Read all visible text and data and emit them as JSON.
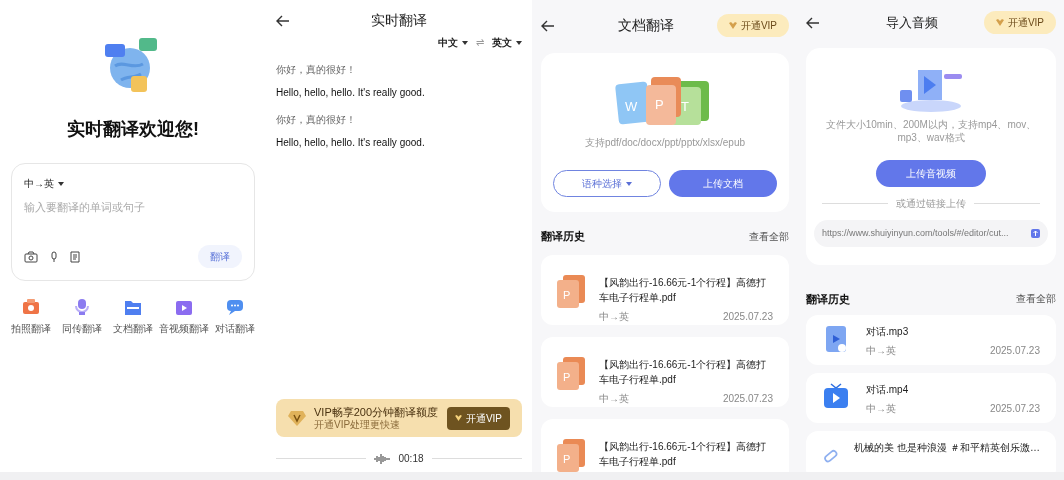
{
  "welcome": {
    "title": "实时翻译欢迎您!",
    "lang_pair": "中→英",
    "placeholder": "输入要翻译的单词或句子",
    "translate_button": "翻译",
    "tools": [
      {
        "kind": "camera",
        "label": "拍照翻译"
      },
      {
        "kind": "interpreter",
        "label": "同传翻译"
      },
      {
        "kind": "document",
        "label": "文档翻译"
      },
      {
        "kind": "video",
        "label": "音视频翻译"
      },
      {
        "kind": "chat",
        "label": "对话翻译"
      }
    ]
  },
  "live": {
    "title": "实时翻译",
    "source_lang": "中文",
    "swap": "⇌",
    "target_lang": "英文",
    "lines": [
      {
        "kind": "source",
        "text": "你好，真的很好！"
      },
      {
        "kind": "target",
        "text": "Hello, hello, hello. It's really good."
      },
      {
        "kind": "source",
        "text": "你好，真的很好！"
      },
      {
        "kind": "target",
        "text": "Hello, hello, hello. It's really good."
      }
    ],
    "vip_banner": {
      "title": "VIP畅享200分钟翻译额度",
      "subtitle": "开通VIP处理更快速",
      "button": "开通VIP"
    },
    "recording_time": "00:18"
  },
  "document": {
    "title": "文档翻译",
    "vip_button": "开通VIP",
    "file_badges": [
      "W",
      "P",
      "T"
    ],
    "formats": "支持pdf/doc/docx/ppt/pptx/xlsx/epub",
    "language_select": "语种选择",
    "upload_button": "上传文档",
    "history_title": "翻译历史",
    "view_all": "查看全部",
    "history": [
      {
        "badge": "P",
        "name": "【风韵出行-16.66元-1个行程】高德打车电子行程单.pdf",
        "langs": "中→英",
        "date": "2025.07.23"
      },
      {
        "badge": "P",
        "name": "【风韵出行-16.66元-1个行程】高德打车电子行程单.pdf",
        "langs": "中→英",
        "date": "2025.07.23"
      },
      {
        "badge": "P",
        "name": "【风韵出行-16.66元-1个行程】高德打车电子行程单.pdf"
      }
    ]
  },
  "audio": {
    "title": "导入音频",
    "vip_button": "开通VIP",
    "limits": "文件大小10min、200M以内，支持mp4、mov、mp3、wav格式",
    "upload_button": "上传音视频",
    "divider": "或通过链接上传",
    "url": "https://www.shuiyinyun.com/tools/#/editor/cut...",
    "history_title": "翻译历史",
    "view_all": "查看全部",
    "history": [
      {
        "kind": "audio",
        "name": "对话.mp3",
        "langs": "中→英",
        "date": "2025.07.23"
      },
      {
        "kind": "video",
        "name": "对话.mp4",
        "langs": "中→英",
        "date": "2025.07.23"
      },
      {
        "kind": "link",
        "name": "机械的美 也是种浪漫 ＃和平精英创乐激…"
      }
    ]
  }
}
